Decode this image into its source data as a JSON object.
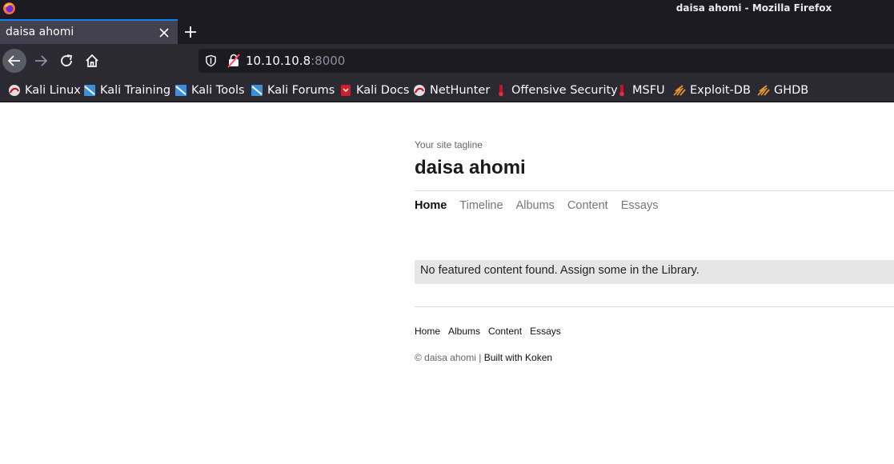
{
  "window": {
    "title": "daisa ahomi - Mozilla Firefox"
  },
  "tab": {
    "title": "daisa ahomi"
  },
  "urlbar": {
    "host": "10.10.10.8",
    "port": ":8000"
  },
  "bookmarks": [
    {
      "label": "Kali Linux",
      "icon": "kali-dragon-icon"
    },
    {
      "label": "Kali Training",
      "icon": "kali-training-icon"
    },
    {
      "label": "Kali Tools",
      "icon": "kali-tools-icon"
    },
    {
      "label": "Kali Forums",
      "icon": "kali-forums-icon"
    },
    {
      "label": "Kali Docs",
      "icon": "kali-docs-icon"
    },
    {
      "label": "NetHunter",
      "icon": "nethunter-icon"
    },
    {
      "label": "Offensive Security",
      "icon": "offsec-icon"
    },
    {
      "label": "MSFU",
      "icon": "msfu-icon"
    },
    {
      "label": "Exploit-DB",
      "icon": "exploitdb-icon"
    },
    {
      "label": "GHDB",
      "icon": "ghdb-icon"
    }
  ],
  "site": {
    "tagline": "Your site tagline",
    "title": "daisa ahomi",
    "nav": [
      "Home",
      "Timeline",
      "Albums",
      "Content",
      "Essays"
    ],
    "active_nav": "Home",
    "notice": "No featured content found. Assign some in the Library.",
    "footer_nav": [
      "Home",
      "Albums",
      "Content",
      "Essays"
    ],
    "copyright": "© daisa ahomi |",
    "built_with": "Built with Koken"
  },
  "colors": {
    "chrome_dark": "#1c1b22",
    "toolbar": "#2b2a33",
    "tab_active": "#42414d",
    "accent": "#0a84ff",
    "notice_bg": "#e6e6e6"
  }
}
